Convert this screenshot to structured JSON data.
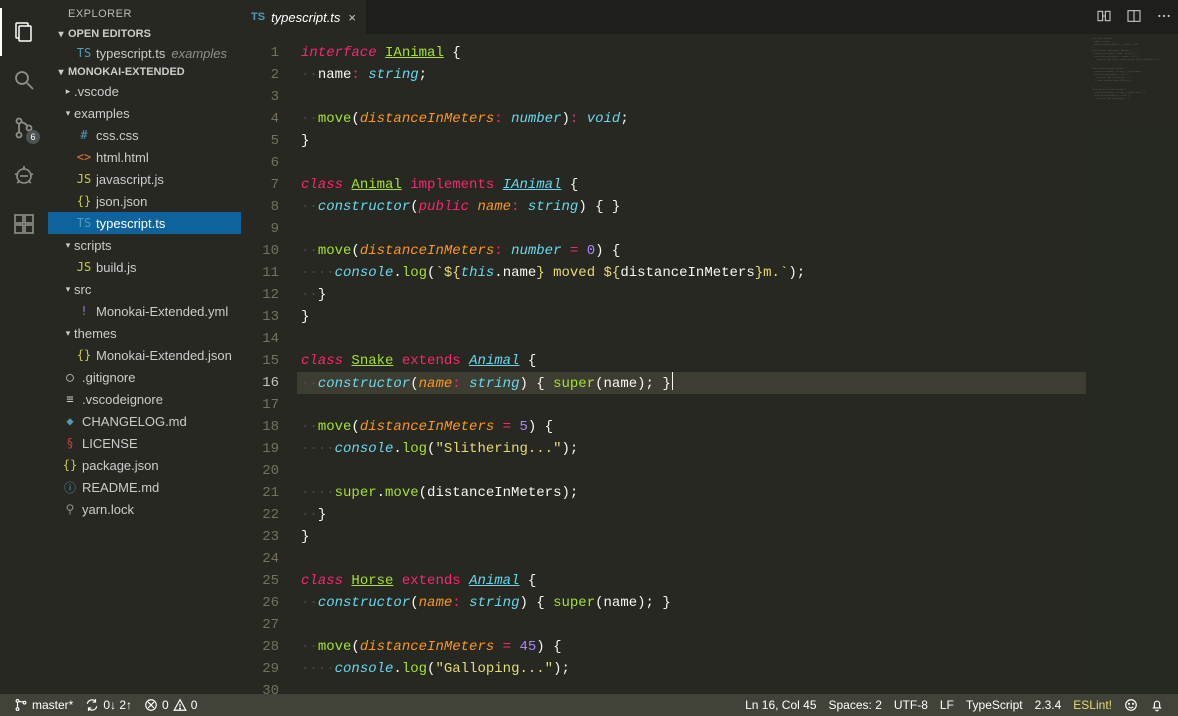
{
  "sidebar": {
    "title": "EXPLORER",
    "openEditors": {
      "header": "OPEN EDITORS",
      "items": [
        {
          "icon": "TS",
          "iconClass": "ic-ts",
          "label": "typescript.ts",
          "detail": "examples"
        }
      ]
    },
    "folder": {
      "header": "MONOKAI-EXTENDED",
      "tree": [
        {
          "depth": 0,
          "type": "folder",
          "expanded": false,
          "label": ".vscode"
        },
        {
          "depth": 0,
          "type": "folder",
          "expanded": true,
          "label": "examples"
        },
        {
          "depth": 1,
          "type": "file",
          "icon": "#",
          "iconClass": "ic-css",
          "label": "css.css"
        },
        {
          "depth": 1,
          "type": "file",
          "icon": "<>",
          "iconClass": "ic-html",
          "label": "html.html"
        },
        {
          "depth": 1,
          "type": "file",
          "icon": "JS",
          "iconClass": "ic-js",
          "label": "javascript.js"
        },
        {
          "depth": 1,
          "type": "file",
          "icon": "{}",
          "iconClass": "ic-json",
          "label": "json.json"
        },
        {
          "depth": 1,
          "type": "file",
          "icon": "TS",
          "iconClass": "ic-ts",
          "label": "typescript.ts",
          "selected": true
        },
        {
          "depth": 0,
          "type": "folder",
          "expanded": true,
          "label": "scripts"
        },
        {
          "depth": 1,
          "type": "file",
          "icon": "JS",
          "iconClass": "ic-js",
          "label": "build.js"
        },
        {
          "depth": 0,
          "type": "folder",
          "expanded": true,
          "label": "src"
        },
        {
          "depth": 1,
          "type": "file",
          "icon": "!",
          "iconClass": "ic-yml",
          "label": "Monokai-Extended.yml"
        },
        {
          "depth": 0,
          "type": "folder",
          "expanded": true,
          "label": "themes"
        },
        {
          "depth": 1,
          "type": "file",
          "icon": "{}",
          "iconClass": "ic-json",
          "label": "Monokai-Extended.json"
        },
        {
          "depth": 0,
          "type": "file",
          "icon": "◯",
          "iconClass": "ic-git",
          "label": ".gitignore"
        },
        {
          "depth": 0,
          "type": "file",
          "icon": "≡",
          "iconClass": "ic-git",
          "label": ".vscodeignore"
        },
        {
          "depth": 0,
          "type": "file",
          "icon": "◆",
          "iconClass": "ic-md",
          "label": "CHANGELOG.md"
        },
        {
          "depth": 0,
          "type": "file",
          "icon": "§",
          "iconClass": "ic-lic",
          "label": "LICENSE"
        },
        {
          "depth": 0,
          "type": "file",
          "icon": "{}",
          "iconClass": "ic-json",
          "label": "package.json"
        },
        {
          "depth": 0,
          "type": "file",
          "icon": "ⓘ",
          "iconClass": "ic-info",
          "label": "README.md"
        },
        {
          "depth": 0,
          "type": "file",
          "icon": "⚲",
          "iconClass": "ic-lock",
          "label": "yarn.lock"
        }
      ]
    }
  },
  "activity": {
    "scmBadge": "6"
  },
  "tab": {
    "icon": "TS",
    "label": "typescript.ts"
  },
  "code": {
    "currentLine": 16,
    "lines": [
      [
        [
          "kw",
          "interface"
        ],
        [
          "punc",
          " "
        ],
        [
          "cls",
          "IAnimal"
        ],
        [
          "punc",
          " {"
        ]
      ],
      [
        [
          "ig",
          "··"
        ],
        [
          "prop",
          "name"
        ],
        [
          "op",
          ":"
        ],
        [
          "punc",
          " "
        ],
        [
          "st",
          "string"
        ],
        [
          "punc",
          ";"
        ]
      ],
      [],
      [
        [
          "ig",
          "··"
        ],
        [
          "fn",
          "move"
        ],
        [
          "punc",
          "("
        ],
        [
          "param",
          "distanceInMeters"
        ],
        [
          "op",
          ":"
        ],
        [
          "punc",
          " "
        ],
        [
          "st",
          "number"
        ],
        [
          "punc",
          ")"
        ],
        [
          "op",
          ":"
        ],
        [
          "punc",
          " "
        ],
        [
          "st",
          "void"
        ],
        [
          "punc",
          ";"
        ]
      ],
      [
        [
          "punc",
          "}"
        ]
      ],
      [],
      [
        [
          "kw",
          "class"
        ],
        [
          "punc",
          " "
        ],
        [
          "cls",
          "Animal"
        ],
        [
          "punc",
          " "
        ],
        [
          "kw2",
          "implements"
        ],
        [
          "punc",
          " "
        ],
        [
          "clsr",
          "IAnimal"
        ],
        [
          "punc",
          " {"
        ]
      ],
      [
        [
          "ig",
          "··"
        ],
        [
          "st",
          "constructor"
        ],
        [
          "punc",
          "("
        ],
        [
          "kw",
          "public"
        ],
        [
          "punc",
          " "
        ],
        [
          "param",
          "name"
        ],
        [
          "op",
          ":"
        ],
        [
          "punc",
          " "
        ],
        [
          "st",
          "string"
        ],
        [
          "punc",
          ") { }"
        ]
      ],
      [],
      [
        [
          "ig",
          "··"
        ],
        [
          "fn",
          "move"
        ],
        [
          "punc",
          "("
        ],
        [
          "param",
          "distanceInMeters"
        ],
        [
          "op",
          ":"
        ],
        [
          "punc",
          " "
        ],
        [
          "st",
          "number"
        ],
        [
          "punc",
          " "
        ],
        [
          "op",
          "="
        ],
        [
          "punc",
          " "
        ],
        [
          "num",
          "0"
        ],
        [
          "punc",
          ") {"
        ]
      ],
      [
        [
          "ig",
          "····"
        ],
        [
          "varc",
          "console"
        ],
        [
          "punc",
          "."
        ],
        [
          "fn",
          "log"
        ],
        [
          "punc",
          "("
        ],
        [
          "str",
          "`${"
        ],
        [
          "varc",
          "this"
        ],
        [
          "punc",
          "."
        ],
        [
          "prop",
          "name"
        ],
        [
          "str",
          "} moved ${"
        ],
        [
          "prop",
          "distanceInMeters"
        ],
        [
          "str",
          "}m.`"
        ],
        [
          "punc",
          ");"
        ]
      ],
      [
        [
          "ig",
          "··"
        ],
        [
          "punc",
          "}"
        ]
      ],
      [
        [
          "punc",
          "}"
        ]
      ],
      [],
      [
        [
          "kw",
          "class"
        ],
        [
          "punc",
          " "
        ],
        [
          "cls",
          "Snake"
        ],
        [
          "punc",
          " "
        ],
        [
          "kw2",
          "extends"
        ],
        [
          "punc",
          " "
        ],
        [
          "clsr",
          "Animal"
        ],
        [
          "punc",
          " {"
        ]
      ],
      [
        [
          "ig",
          "··"
        ],
        [
          "st",
          "constructor"
        ],
        [
          "punc",
          "("
        ],
        [
          "param",
          "name"
        ],
        [
          "op",
          ":"
        ],
        [
          "punc",
          " "
        ],
        [
          "st",
          "string"
        ],
        [
          "punc",
          ") { "
        ],
        [
          "fn",
          "super"
        ],
        [
          "punc",
          "(name); }"
        ]
      ],
      [],
      [
        [
          "ig",
          "··"
        ],
        [
          "fn",
          "move"
        ],
        [
          "punc",
          "("
        ],
        [
          "param",
          "distanceInMeters"
        ],
        [
          "punc",
          " "
        ],
        [
          "op",
          "="
        ],
        [
          "punc",
          " "
        ],
        [
          "num",
          "5"
        ],
        [
          "punc",
          ") {"
        ]
      ],
      [
        [
          "ig",
          "····"
        ],
        [
          "varc",
          "console"
        ],
        [
          "punc",
          "."
        ],
        [
          "fn",
          "log"
        ],
        [
          "punc",
          "("
        ],
        [
          "str",
          "\"Slithering...\""
        ],
        [
          "punc",
          ");"
        ]
      ],
      [],
      [
        [
          "ig",
          "····"
        ],
        [
          "fn",
          "super"
        ],
        [
          "punc",
          "."
        ],
        [
          "fn",
          "move"
        ],
        [
          "punc",
          "(distanceInMeters);"
        ]
      ],
      [
        [
          "ig",
          "··"
        ],
        [
          "punc",
          "}"
        ]
      ],
      [
        [
          "punc",
          "}"
        ]
      ],
      [],
      [
        [
          "kw",
          "class"
        ],
        [
          "punc",
          " "
        ],
        [
          "cls",
          "Horse"
        ],
        [
          "punc",
          " "
        ],
        [
          "kw2",
          "extends"
        ],
        [
          "punc",
          " "
        ],
        [
          "clsr",
          "Animal"
        ],
        [
          "punc",
          " {"
        ]
      ],
      [
        [
          "ig",
          "··"
        ],
        [
          "st",
          "constructor"
        ],
        [
          "punc",
          "("
        ],
        [
          "param",
          "name"
        ],
        [
          "op",
          ":"
        ],
        [
          "punc",
          " "
        ],
        [
          "st",
          "string"
        ],
        [
          "punc",
          ") { "
        ],
        [
          "fn",
          "super"
        ],
        [
          "punc",
          "(name); }"
        ]
      ],
      [],
      [
        [
          "ig",
          "··"
        ],
        [
          "fn",
          "move"
        ],
        [
          "punc",
          "("
        ],
        [
          "param",
          "distanceInMeters"
        ],
        [
          "punc",
          " "
        ],
        [
          "op",
          "="
        ],
        [
          "punc",
          " "
        ],
        [
          "num",
          "45"
        ],
        [
          "punc",
          ") {"
        ]
      ],
      [
        [
          "ig",
          "····"
        ],
        [
          "varc",
          "console"
        ],
        [
          "punc",
          "."
        ],
        [
          "fn",
          "log"
        ],
        [
          "punc",
          "("
        ],
        [
          "str",
          "\"Galloping...\""
        ],
        [
          "punc",
          ");"
        ]
      ],
      []
    ]
  },
  "status": {
    "branch": "master*",
    "sync": "0↓ 2↑",
    "errors": "0",
    "warnings": "0",
    "lncol": "Ln 16, Col 45",
    "spaces": "Spaces: 2",
    "encoding": "UTF-8",
    "eol": "LF",
    "language": "TypeScript",
    "ext": "2.3.4",
    "eslint": "ESLint!"
  }
}
